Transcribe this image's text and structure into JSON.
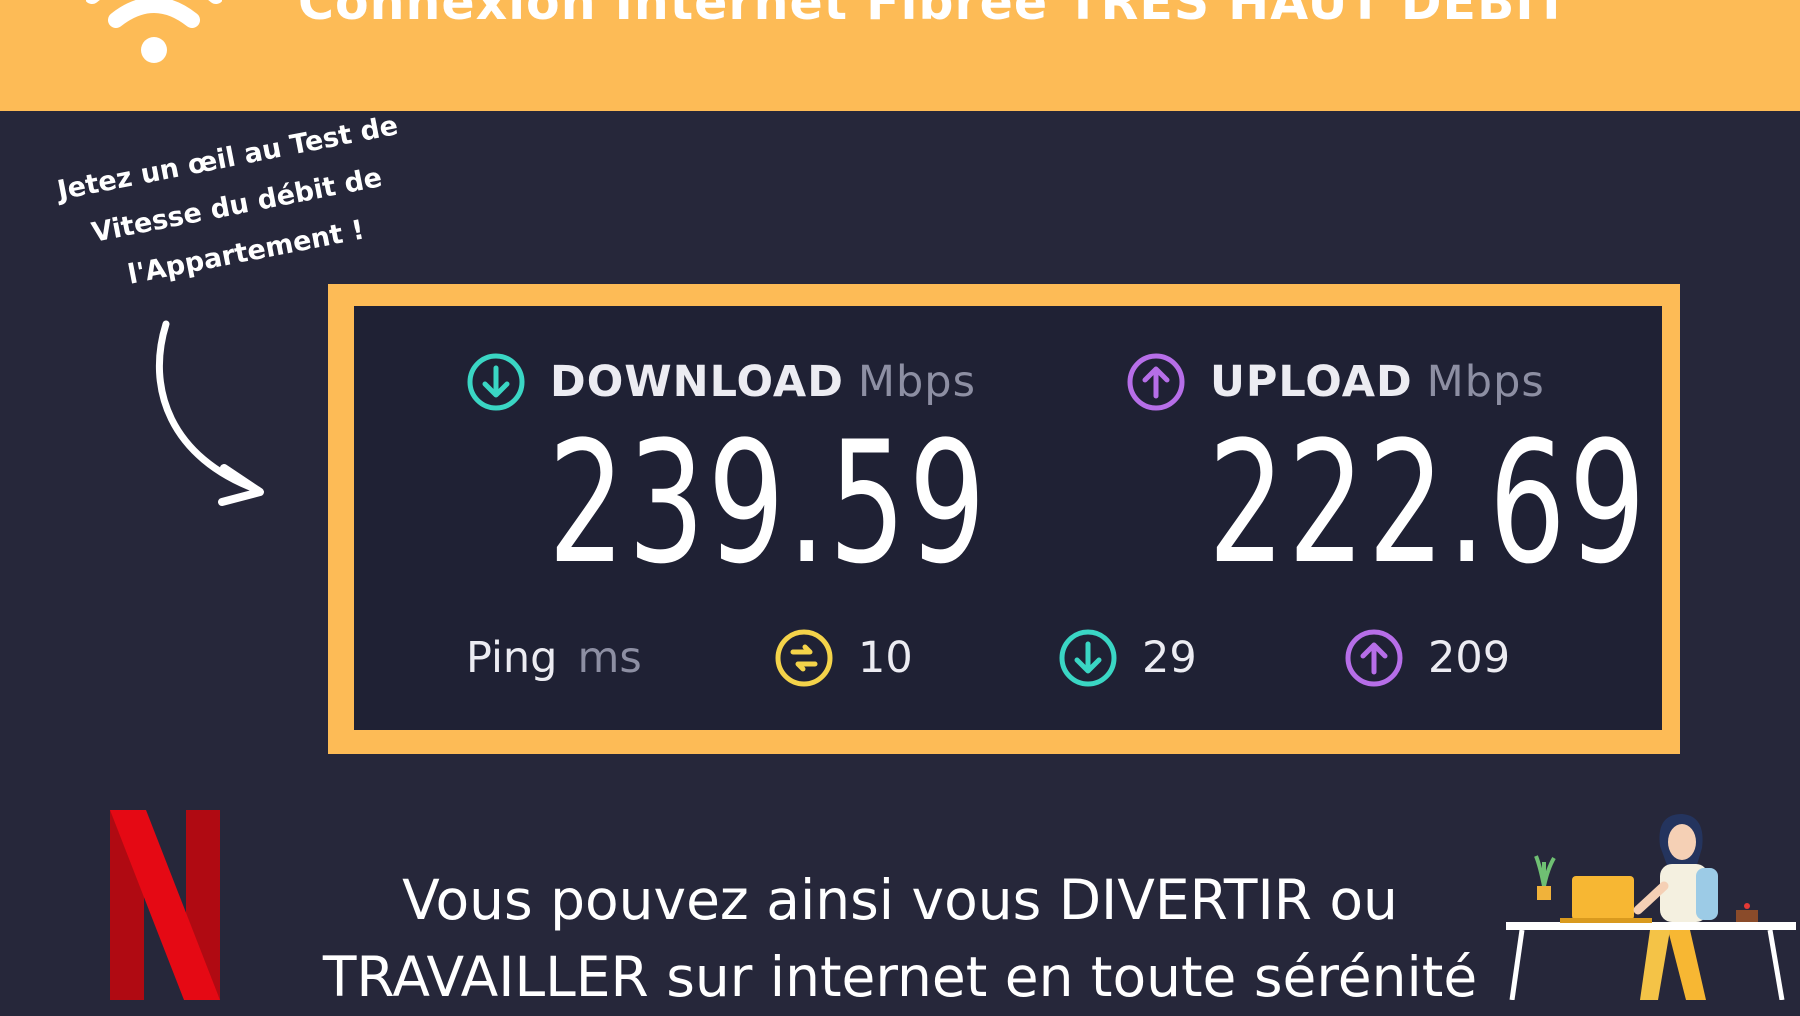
{
  "header": {
    "title": "Connexion Internet Fibrée TRÈS HAUT DÉBIT",
    "bg_color": "#fdbb56"
  },
  "side_note": {
    "lines": [
      "Jetez un œil au Test de",
      "Vitesse du débit de",
      "l'Appartement !"
    ]
  },
  "speedtest": {
    "download": {
      "label": "DOWNLOAD",
      "unit": "Mbps",
      "value": "239.59",
      "icon": "download-arrow-icon",
      "color": "#3ad6c4"
    },
    "upload": {
      "label": "UPLOAD",
      "unit": "Mbps",
      "value": "222.69",
      "icon": "upload-arrow-icon",
      "color": "#b66ee8"
    },
    "ping": {
      "label": "Ping",
      "unit": "ms",
      "idle": {
        "value": "10",
        "icon": "ping-icon",
        "color": "#f4d34a"
      },
      "download": {
        "value": "29",
        "icon": "download-arrow-icon",
        "color": "#3ad6c4"
      },
      "upload": {
        "value": "209",
        "icon": "upload-arrow-icon",
        "color": "#b66ee8"
      }
    }
  },
  "tagline": {
    "line1": "Vous pouvez ainsi vous DIVERTIR ou",
    "line2": "TRAVAILLER sur internet en toute sérénité"
  },
  "icons": {
    "wifi": "wifi-icon",
    "netflix": "netflix-logo",
    "illustration": "person-working-illustration"
  },
  "colors": {
    "background": "#26273a",
    "panel": "#1f2134",
    "frame": "#fdbb56"
  }
}
